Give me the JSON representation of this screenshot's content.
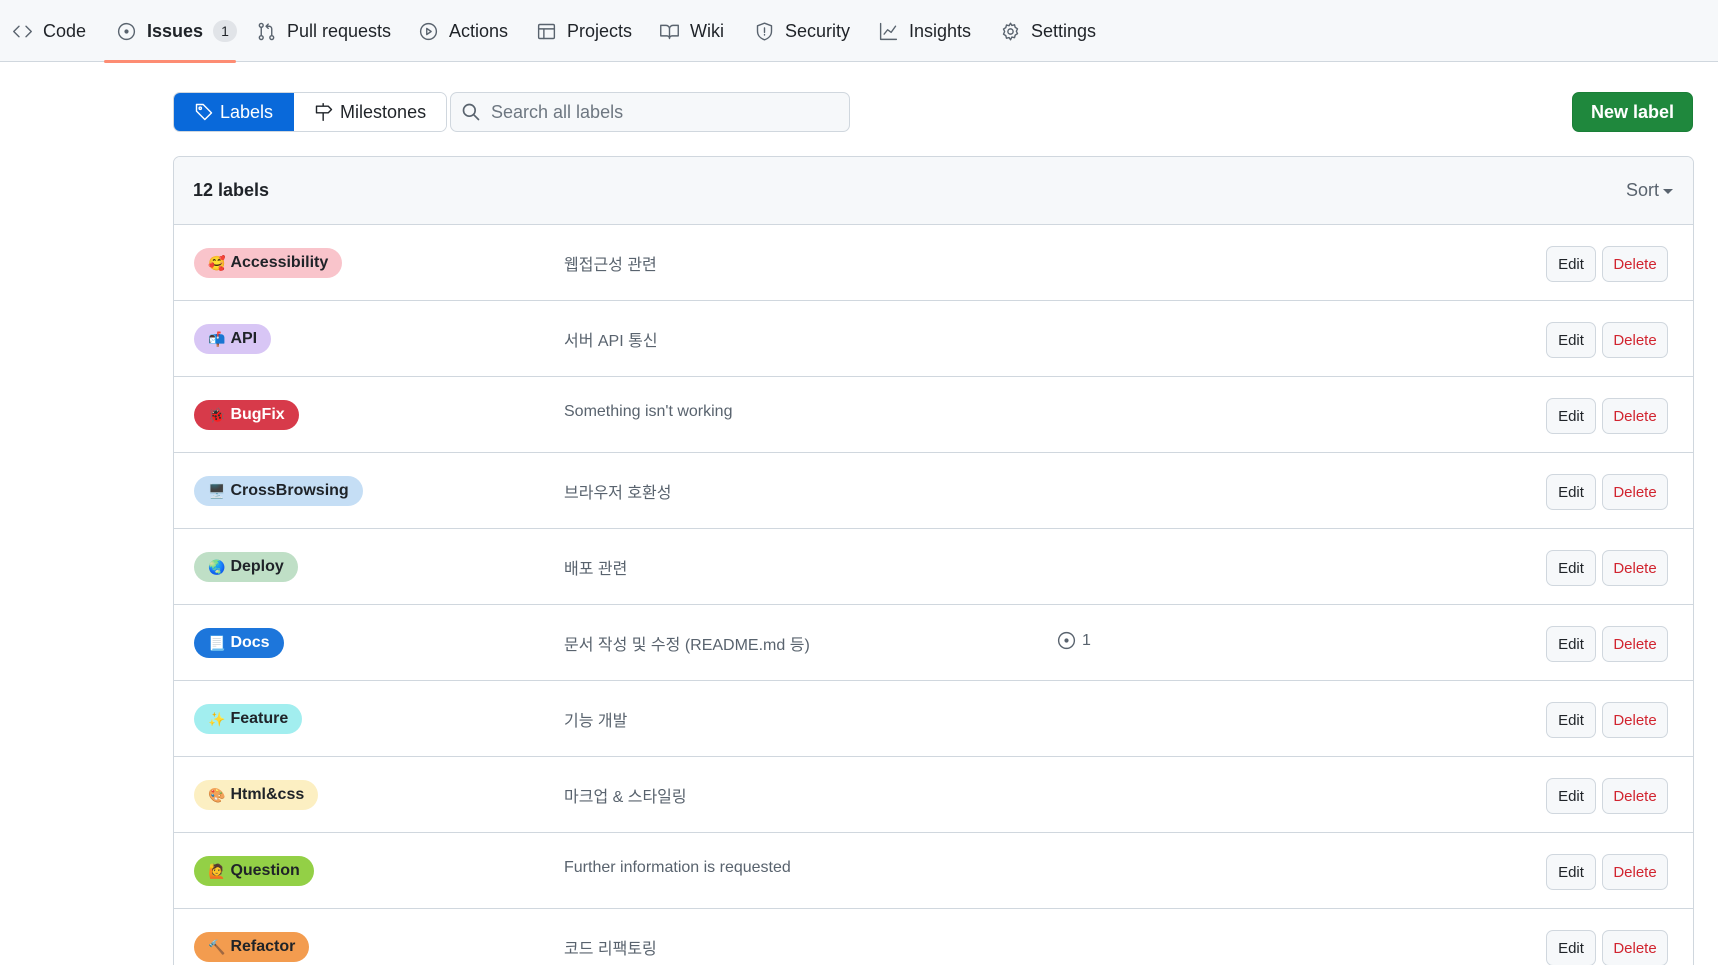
{
  "nav": {
    "items": [
      {
        "label": "Code",
        "icon": "code-icon"
      },
      {
        "label": "Issues",
        "icon": "issue-opened-icon",
        "count": "1",
        "active": true
      },
      {
        "label": "Pull requests",
        "icon": "git-pull-request-icon"
      },
      {
        "label": "Actions",
        "icon": "play-icon"
      },
      {
        "label": "Projects",
        "icon": "table-icon"
      },
      {
        "label": "Wiki",
        "icon": "book-icon"
      },
      {
        "label": "Security",
        "icon": "shield-icon"
      },
      {
        "label": "Insights",
        "icon": "graph-icon"
      },
      {
        "label": "Settings",
        "icon": "gear-icon"
      }
    ]
  },
  "subnav": {
    "labels": "Labels",
    "milestones": "Milestones"
  },
  "search": {
    "placeholder": "Search all labels"
  },
  "new_label_button": "New label",
  "list": {
    "count_text": "12 labels",
    "sort": "Sort",
    "edit": "Edit",
    "delete": "Delete",
    "labels": [
      {
        "name": "Accessibility",
        "emoji": "🥰",
        "description": "웹접근성 관련",
        "bg": "#f9c4cb",
        "fg": "#1f2328"
      },
      {
        "name": "API",
        "emoji": "📬",
        "description": "서버 API 통신",
        "bg": "#d8c6f5",
        "fg": "#1f2328"
      },
      {
        "name": "BugFix",
        "emoji": "🐞",
        "description": "Something isn't working",
        "bg": "#d73a4a",
        "fg": "#ffffff"
      },
      {
        "name": "CrossBrowsing",
        "emoji": "🖥️",
        "description": "브라우저 호환성",
        "bg": "#c5def5",
        "fg": "#1f2328"
      },
      {
        "name": "Deploy",
        "emoji": "🌏",
        "description": "배포 관련",
        "bg": "#bfdfc6",
        "fg": "#1f2328"
      },
      {
        "name": "Docs",
        "emoji": "📃",
        "description": "문서 작성 및 수정 (README.md 등)",
        "bg": "#1d76db",
        "fg": "#ffffff",
        "issues": "1"
      },
      {
        "name": "Feature",
        "emoji": "✨",
        "description": "기능 개발",
        "bg": "#a2eeef",
        "fg": "#1f2328"
      },
      {
        "name": "Html&css",
        "emoji": "🎨",
        "description": "마크업 & 스타일링",
        "bg": "#fcefc2",
        "fg": "#1f2328"
      },
      {
        "name": "Question",
        "emoji": "🙋",
        "description": "Further information is requested",
        "bg": "#93d046",
        "fg": "#1f2328"
      },
      {
        "name": "Refactor",
        "emoji": "🔨",
        "description": "코드 리팩토링",
        "bg": "#f39c4f",
        "fg": "#1f2328"
      }
    ]
  }
}
